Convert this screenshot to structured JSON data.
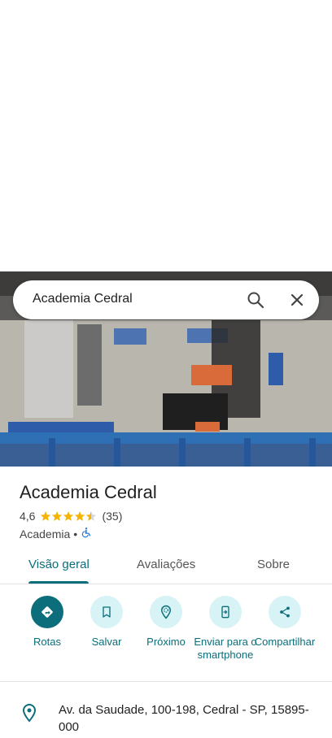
{
  "search": {
    "query": "Academia Cedral"
  },
  "place": {
    "name": "Academia Cedral",
    "rating": "4,6",
    "stars": 4.5,
    "review_count": "(35)",
    "category": "Academia",
    "separator": "•"
  },
  "tabs": [
    {
      "label": "Visão geral",
      "active": true
    },
    {
      "label": "Avaliações",
      "active": false
    },
    {
      "label": "Sobre",
      "active": false
    }
  ],
  "actions": [
    {
      "label": "Rotas",
      "icon": "directions-icon"
    },
    {
      "label": "Salvar",
      "icon": "bookmark-icon"
    },
    {
      "label": "Próximo",
      "icon": "nearby-icon"
    },
    {
      "label": "Enviar para o smartphone",
      "icon": "send-to-phone-icon"
    },
    {
      "label": "Compartilhar",
      "icon": "share-icon"
    }
  ],
  "address": {
    "text": "Av. da Saudade, 100-198, Cedral - SP, 15895-000"
  },
  "colors": {
    "accent": "#0b6e7a",
    "star": "#f4b400",
    "chip_bg": "#d8f3f5"
  }
}
